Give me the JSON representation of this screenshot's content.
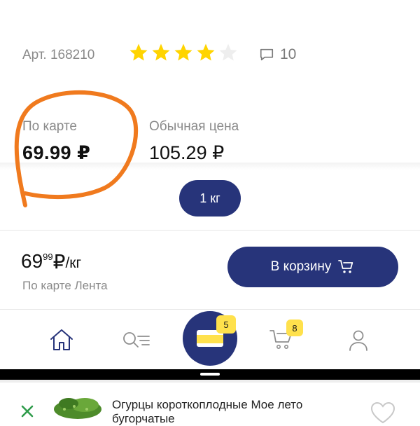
{
  "product": {
    "article": "Арт. 168210",
    "rating_stars_filled": 4,
    "rating_stars_total": 5,
    "comment_count": "10",
    "title_line1": "Огурцы короткоплодные Мое лето",
    "title_line2": "бугорчатые"
  },
  "prices": {
    "card_label": "По карте",
    "card_price": "69.99 ₽",
    "regular_label": "Обычная цена",
    "regular_price": "105.29 ₽",
    "unit_option": "1 кг"
  },
  "purchase": {
    "price_main": "69",
    "price_cents": "99",
    "currency": "₽",
    "unit": "/кг",
    "caption": "По карте Лента",
    "cart_button": "В корзину"
  },
  "nav": {
    "card_badge": "5",
    "cart_badge": "8"
  },
  "colors": {
    "brand_blue": "#27347a",
    "star_yellow": "#ffd400",
    "badge_yellow": "#ffe14c",
    "annotation_orange": "#f07a1e",
    "close_green": "#2e9b4a"
  }
}
